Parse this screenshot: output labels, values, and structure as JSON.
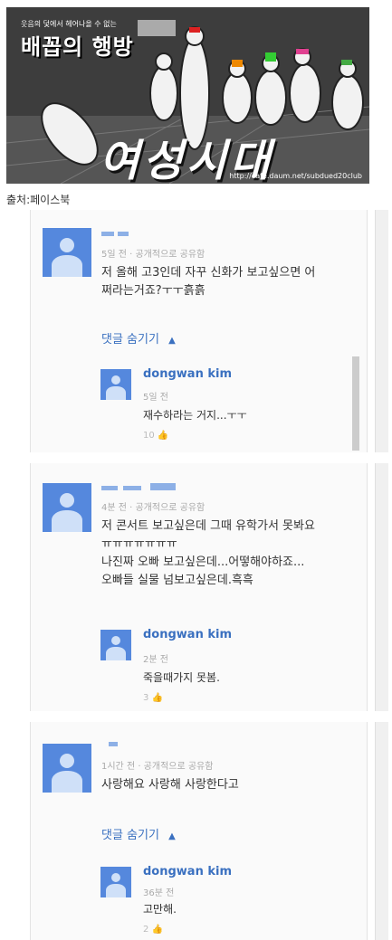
{
  "banner": {
    "small_text": "웃음의 덫에서 헤어나올 수 없는",
    "title": "배꼽의 행방",
    "big_text": "여성시대",
    "url": "http://cafe.daum.net/subdued20club"
  },
  "source": "출처:페이스북",
  "comments": [
    {
      "meta": "5일 전 · 공개적으로 공유함",
      "lines": [
        "저 올해 고3인데 자꾸 신화가 보고싶으면 어",
        "쩌라는거죠?ㅜㅜ흙흙"
      ],
      "hide_label": "댓글 숨기기",
      "hide_icon": "chevron-up-icon",
      "reply": {
        "name": "dongwan kim",
        "meta": "5일 전",
        "text": "재수하라는 거지...ㅜㅜ",
        "likes": "10"
      }
    },
    {
      "meta": "4분 전 · 공개적으로 공유함",
      "lines": [
        "저 콘서트 보고싶은데 그때 유학가서 못봐요",
        "ㅠㅠㅠㅠㅠㅠㅠ",
        "나진짜 오빠 보고싶은데...어떻해야하죠...",
        "오빠들 실물 넘보고싶은데.흑흑"
      ],
      "reply": {
        "name": "dongwan kim",
        "meta": "2분 전",
        "text": "죽을때가지 못봄.",
        "likes": "3"
      }
    },
    {
      "meta": "1시간 전 · 공개적으로 공유함",
      "lines": [
        "사랑해요 사랑해 사랑한다고"
      ],
      "hide_label": "댓글 숨기기",
      "hide_icon": "chevron-up-icon",
      "reply": {
        "name": "dongwan kim",
        "meta": "36분 전",
        "text": "고만해.",
        "likes": "2"
      }
    }
  ]
}
